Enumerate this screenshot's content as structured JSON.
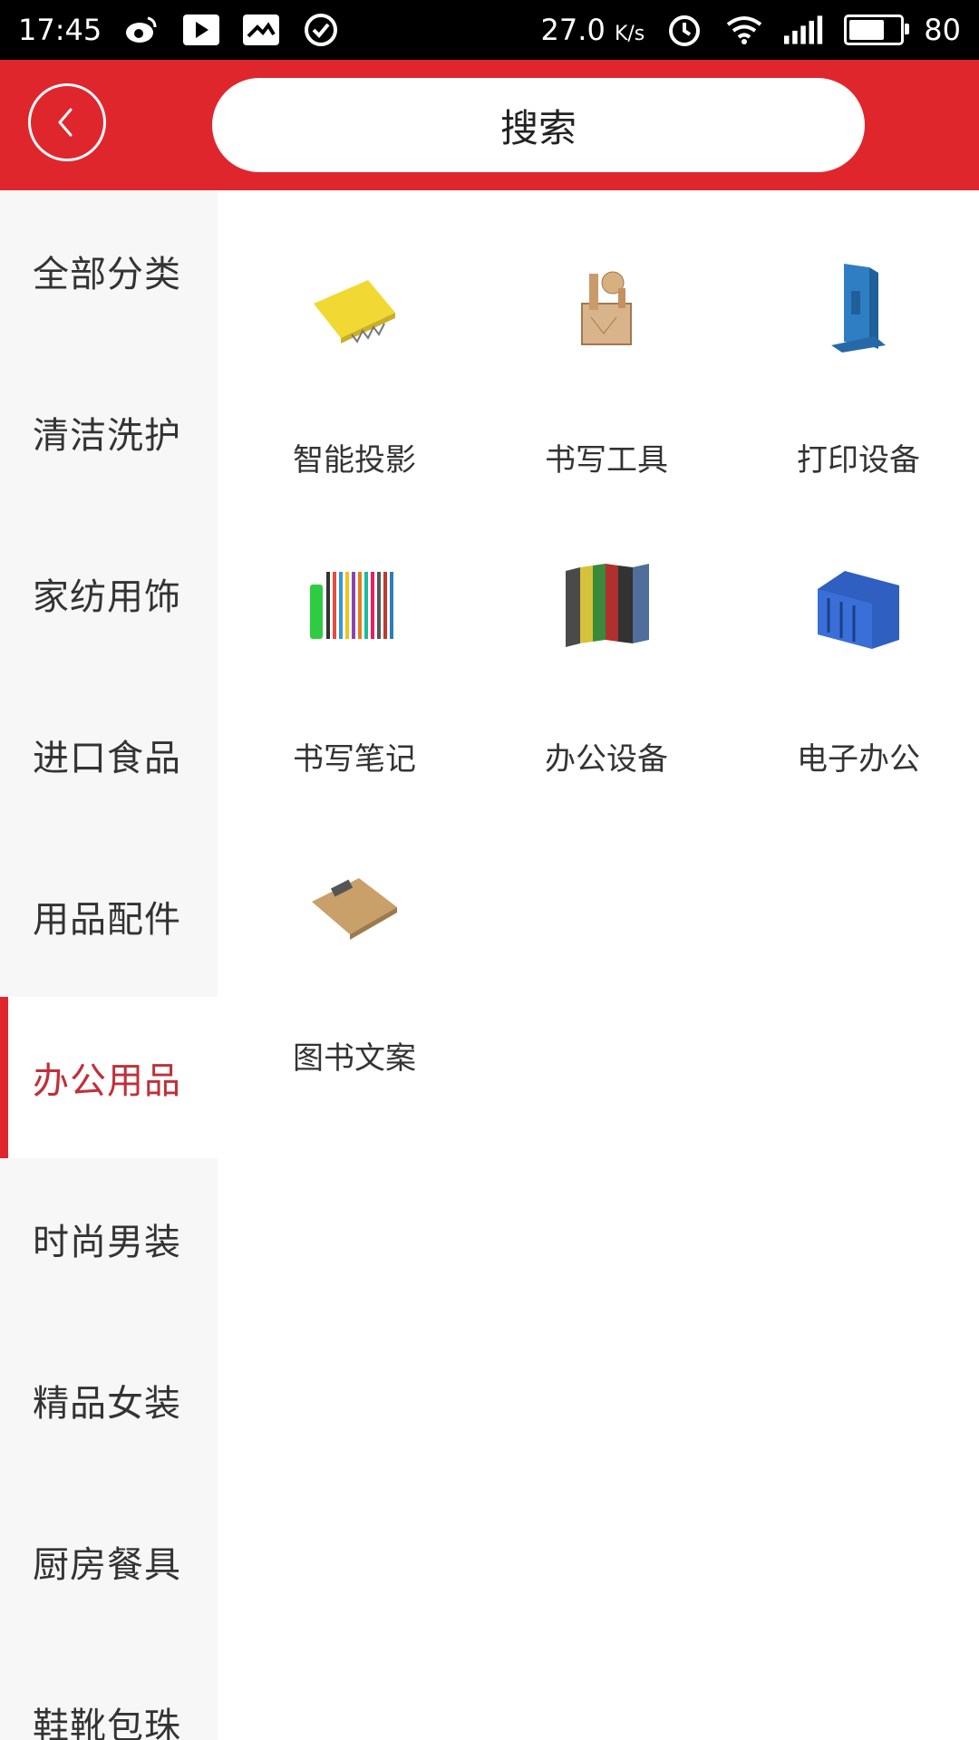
{
  "status_bar": {
    "time": "17:45",
    "net_speed": "27.0",
    "net_unit": "K/s",
    "battery": "80",
    "battery_level": 0.8
  },
  "header": {
    "search_placeholder": "搜索"
  },
  "sidebar": {
    "items": [
      {
        "label": "全部分类"
      },
      {
        "label": "清洁洗护"
      },
      {
        "label": "家纺用饰"
      },
      {
        "label": "进口食品"
      },
      {
        "label": "用品配件"
      },
      {
        "label": "办公用品"
      },
      {
        "label": "时尚男装"
      },
      {
        "label": "精品女装"
      },
      {
        "label": "厨房餐具"
      },
      {
        "label": "鞋靴包珠"
      }
    ],
    "active_index": 5
  },
  "grid": {
    "items": [
      {
        "label": "智能投影",
        "icon": "notebook-icon"
      },
      {
        "label": "书写工具",
        "icon": "pen-holder-icon"
      },
      {
        "label": "打印设备",
        "icon": "bookend-icon"
      },
      {
        "label": "书写笔记",
        "icon": "pens-icon"
      },
      {
        "label": "办公设备",
        "icon": "binders-icon"
      },
      {
        "label": "电子办公",
        "icon": "file-rack-icon"
      },
      {
        "label": "图书文案",
        "icon": "clipboard-icon"
      }
    ]
  },
  "colors": {
    "accent": "#e0262d",
    "active_text": "#c0303a"
  }
}
